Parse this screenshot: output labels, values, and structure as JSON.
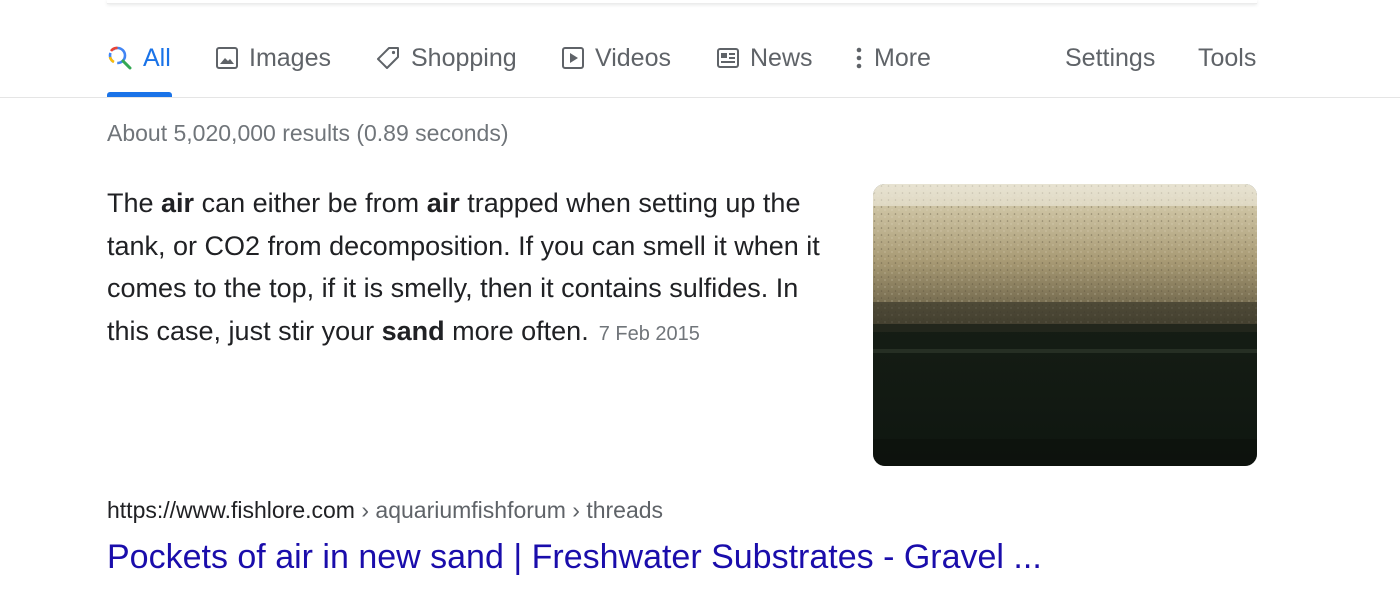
{
  "tabs": [
    {
      "label": "All",
      "icon": "search-icon",
      "active": true
    },
    {
      "label": "Images",
      "icon": "image-icon"
    },
    {
      "label": "Shopping",
      "icon": "tag-icon"
    },
    {
      "label": "Videos",
      "icon": "play-icon"
    },
    {
      "label": "News",
      "icon": "newspaper-icon"
    },
    {
      "label": "More",
      "icon": "more-vert-icon"
    }
  ],
  "tools": {
    "settings_label": "Settings",
    "tools_label": "Tools"
  },
  "results_stats": "About 5,020,000 results (0.89 seconds)",
  "featured_snippet": {
    "parts": [
      {
        "text": "The ",
        "bold": false
      },
      {
        "text": "air",
        "bold": true
      },
      {
        "text": " can either be from ",
        "bold": false
      },
      {
        "text": "air",
        "bold": true
      },
      {
        "text": " trapped when setting up the tank, or CO2 from decomposition. If you can smell it when it comes to the top, if it is smelly, then it contains sulfides. In this case, just stir your ",
        "bold": false
      },
      {
        "text": "sand",
        "bold": true
      },
      {
        "text": " more often.",
        "bold": false
      }
    ],
    "date": "7 Feb 2015"
  },
  "result": {
    "url_domain": "https://www.fishlore.com",
    "url_path": " › aquariumfishforum › threads",
    "title": "Pockets of air in new sand | Freshwater Substrates - Gravel ..."
  },
  "colors": {
    "accent": "#1a73e8",
    "link": "#1a0dab",
    "muted": "#70757a"
  }
}
